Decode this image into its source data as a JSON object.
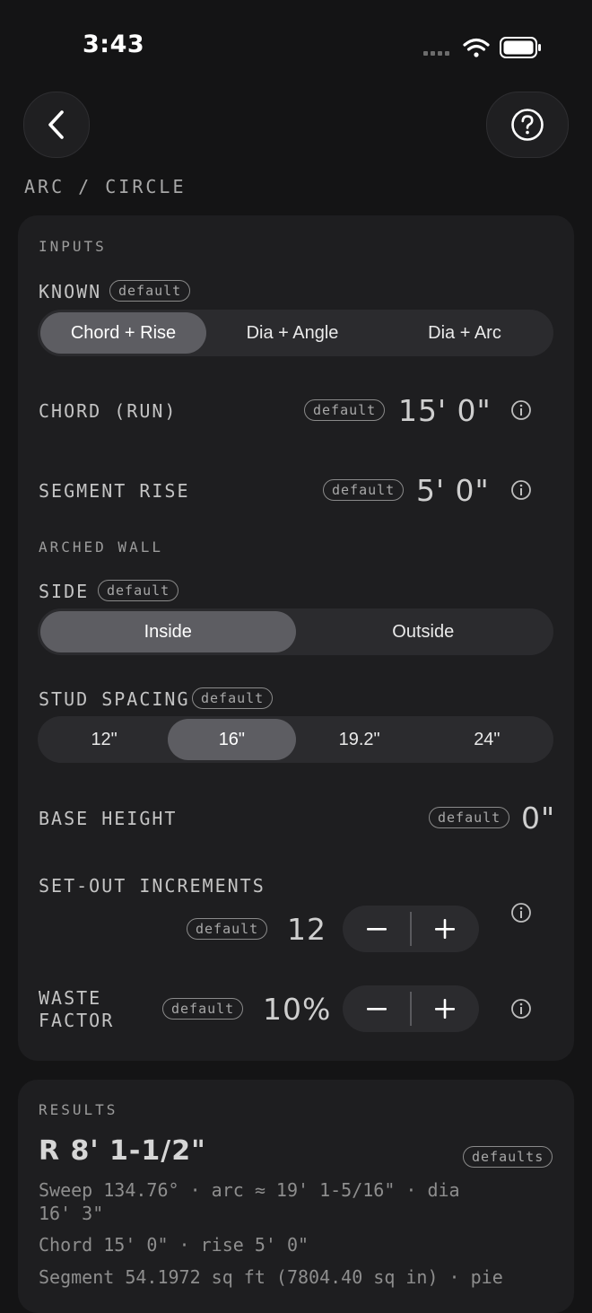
{
  "status": {
    "time": "3:43"
  },
  "header": {
    "breadcrumb": "ARC / CIRCLE"
  },
  "inputs": {
    "section_label": "INPUTS",
    "known": {
      "label": "KNOWN",
      "chip": "default",
      "options": [
        "Chord + Rise",
        "Dia + Angle",
        "Dia + Arc"
      ],
      "selected": "Chord + Rise"
    },
    "chord": {
      "label": "CHORD (RUN)",
      "chip": "default",
      "value": "15' 0\""
    },
    "rise": {
      "label": "SEGMENT RISE",
      "chip": "default",
      "value": "5' 0\""
    },
    "arched_wall_label": "ARCHED WALL",
    "side": {
      "label": "SIDE",
      "chip": "default",
      "options": [
        "Inside",
        "Outside"
      ],
      "selected": "Inside"
    },
    "stud_spacing": {
      "label": "STUD SPACING",
      "chip": "default",
      "options": [
        "12\"",
        "16\"",
        "19.2\"",
        "24\""
      ],
      "selected": "16\""
    },
    "base_height": {
      "label": "BASE HEIGHT",
      "chip": "default",
      "value": "0\""
    },
    "setout": {
      "label": "SET-OUT INCREMENTS",
      "chip": "default",
      "value": "12"
    },
    "waste": {
      "label_line1": "WASTE",
      "label_line2": "FACTOR",
      "chip": "default",
      "value": "10%"
    }
  },
  "results": {
    "section_label": "RESULTS",
    "radius": "R 8' 1-1/2\"",
    "chip": "defaults",
    "line1a": "Sweep 134.76° · arc ≈ 19' 1-5/16\" · dia",
    "line1b": "16' 3\"",
    "line2": "Chord 15' 0\" · rise 5' 0\"",
    "line3": "Segment 54.1972 sq ft (7804.40 sq in) · pie"
  },
  "colors": {
    "background": "#141415",
    "card": "#1e1e20",
    "segment_active": "#5d5d62"
  }
}
